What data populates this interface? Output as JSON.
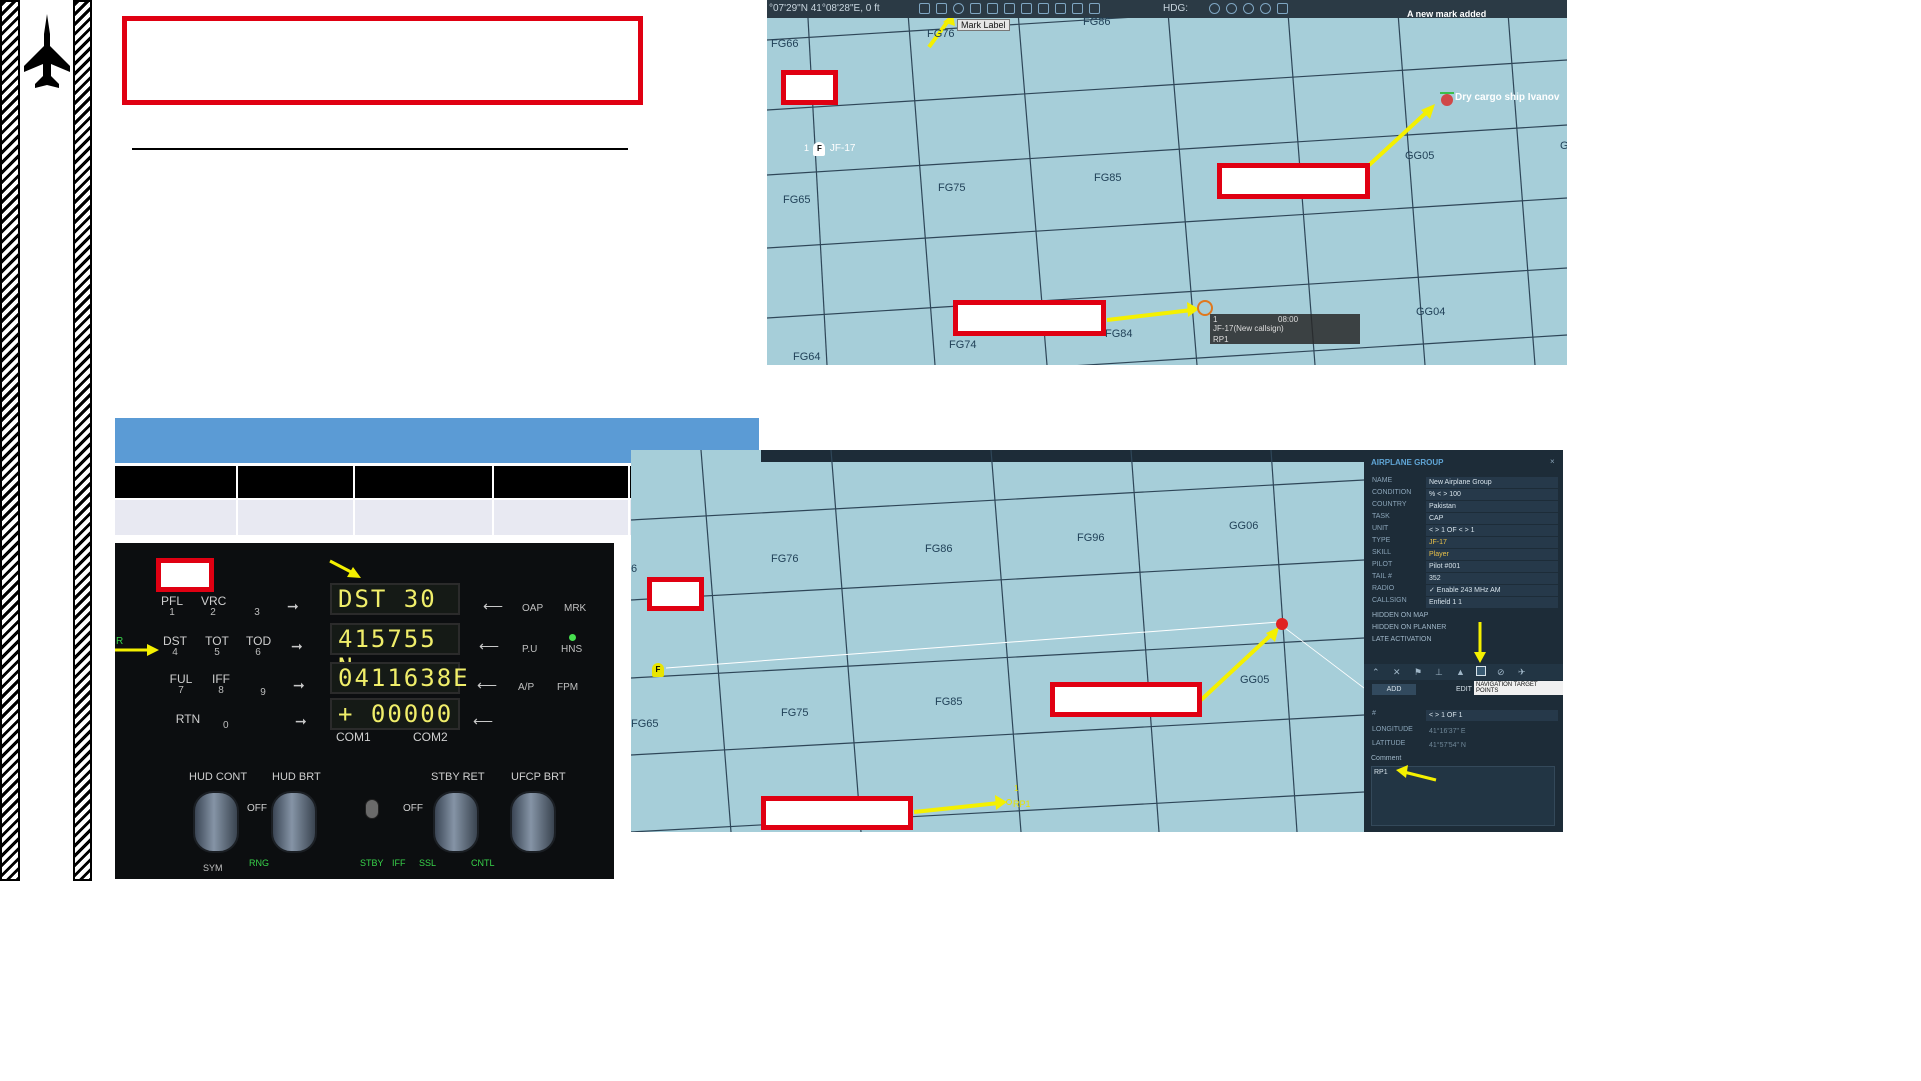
{
  "slide": {
    "title_box_text": "",
    "blue_banner_text": "",
    "table": {
      "headers": [
        "",
        "",
        "",
        "",
        ""
      ],
      "rows": [
        [
          "",
          "",
          "",
          "",
          ""
        ]
      ]
    }
  },
  "map_top": {
    "toolbar": {
      "coords": "°07'29\"N 41°08'28\"E, 0 ft",
      "hdg_label": "HDG:",
      "notification": "A new mark added"
    },
    "tooltip": "Mark Label",
    "ship_label": "Dry cargo ship Ivanov",
    "aircraft_label": "JF-17",
    "aircraft_number": "1",
    "waypoint_box": {
      "time": "08:00",
      "index": "1",
      "name": "JF-17(New callsign)",
      "rp": "RP1"
    },
    "grid_labels": [
      "FG76",
      "FG86",
      "FG66",
      "FG65",
      "FG75",
      "FG85",
      "GG05",
      "GG04",
      "FG74",
      "FG84",
      "FG64",
      "G"
    ]
  },
  "map_bottom": {
    "grid_labels": [
      "FG76",
      "FG86",
      "FG96",
      "GG06",
      "FG75",
      "FG85",
      "GG05",
      "FG65",
      "6"
    ],
    "flag_letter": "F",
    "rp_label": "RP1",
    "rp_number": "1",
    "panel": {
      "title": "AIRPLANE GROUP",
      "fields": [
        {
          "label": "NAME",
          "value": "New Airplane Group"
        },
        {
          "label": "CONDITION",
          "value": "%   < >  100"
        },
        {
          "label": "COUNTRY",
          "value": "Pakistan"
        },
        {
          "label": "TASK",
          "value": "CAP"
        },
        {
          "label": "UNIT",
          "value": "< >  1        OF    < >  1"
        },
        {
          "label": "TYPE",
          "value": "JF-17"
        },
        {
          "label": "SKILL",
          "value": "Player"
        },
        {
          "label": "PILOT",
          "value": "Pilot #001"
        },
        {
          "label": "TAIL #",
          "value": "352"
        },
        {
          "label": "RADIO",
          "value": "✓ Enable        243     MHz   AM"
        },
        {
          "label": "CALLSIGN",
          "value": "Enfield   1   1"
        }
      ],
      "checkboxes": [
        "HIDDEN ON MAP",
        "HIDDEN ON PLANNER",
        "LATE ACTIVATION"
      ],
      "add_label": "ADD",
      "edit_label": "EDIT",
      "tooltip": "NAVIGATION TARGET POINTS",
      "nav_fields": [
        {
          "label": "#",
          "value": "< >  1        OF   1"
        },
        {
          "label": "LONGITUDE",
          "value": "41°16'37\" E"
        },
        {
          "label": "LATITUDE",
          "value": "41°57'54\" N"
        }
      ],
      "comment_label": "Comment",
      "comment_value": "RP1"
    }
  },
  "ufcp": {
    "lcd_lines": [
      "DST   30",
      "415755 N",
      "0411638E",
      "+ 00000"
    ],
    "keys": [
      {
        "label": "PFL",
        "num": "1"
      },
      {
        "label": "VRC",
        "num": "2"
      },
      {
        "label": "",
        "num": "3"
      },
      {
        "label": "DST",
        "num": "4"
      },
      {
        "label": "TOT",
        "num": "5"
      },
      {
        "label": "TOD",
        "num": "6"
      },
      {
        "label": "FUL",
        "num": "7"
      },
      {
        "label": "IFF",
        "num": "8"
      },
      {
        "label": "",
        "num": "9"
      },
      {
        "label": "RTN",
        "num": "0"
      }
    ],
    "right_keys": [
      "OAP",
      "MRK",
      "P.U",
      "HNS",
      "A/P",
      "FPM"
    ],
    "com_labels": [
      "COM1",
      "COM2"
    ],
    "knob_labels": [
      "HUD CONT",
      "HUD BRT",
      "STBY RET",
      "UFCP BRT"
    ],
    "off_labels": [
      "OFF",
      "OFF"
    ],
    "bottom_labels": [
      "SYM",
      "RNG",
      "STBY",
      "IFF",
      "SSL",
      "CNTL"
    ],
    "left_edge_mark": "R"
  },
  "footer_text": "",
  "colors": {
    "accent_red": "#e00012",
    "arrow_yellow": "#f4f000",
    "banner_blue": "#5b9bd5",
    "map_water": "#a6ced9"
  }
}
